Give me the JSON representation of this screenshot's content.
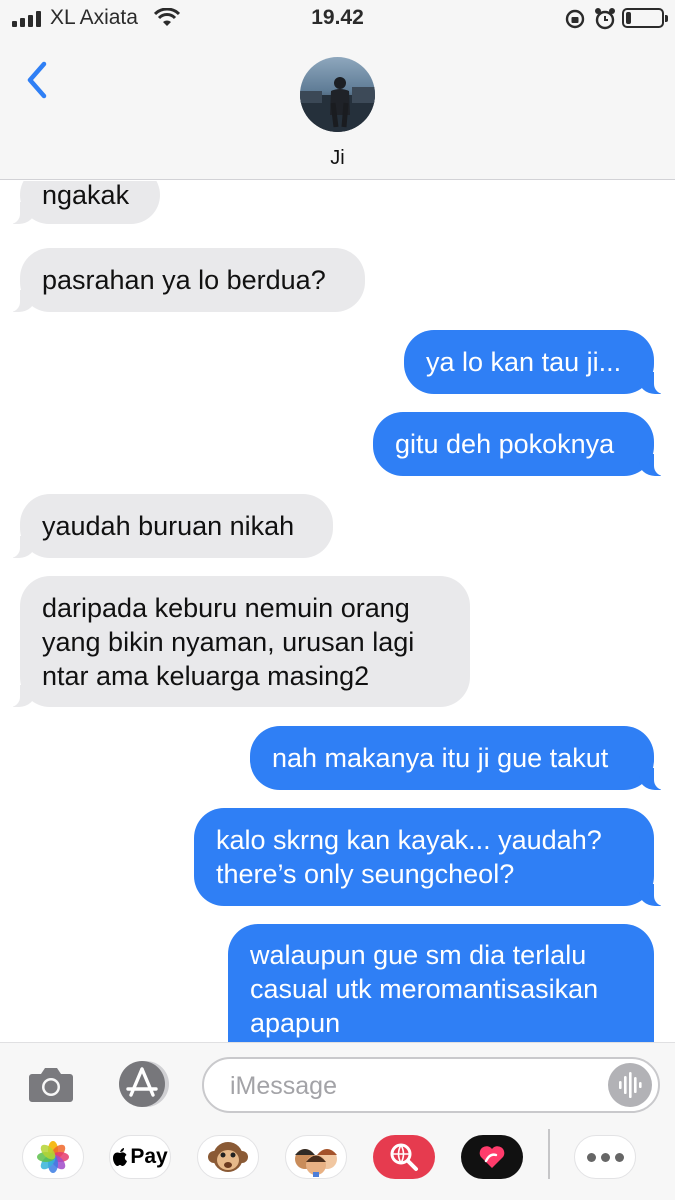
{
  "status_bar": {
    "carrier": "XL Axiata",
    "time": "19.42",
    "battery_level": 0.15
  },
  "header": {
    "contact_name": "Ji",
    "back_icon": "chevron-left-icon"
  },
  "messages": [
    {
      "direction": "incoming",
      "text": "ngakak"
    },
    {
      "direction": "incoming",
      "text": "pasrahan ya lo berdua?"
    },
    {
      "direction": "outgoing",
      "text": "ya lo kan tau ji..."
    },
    {
      "direction": "outgoing",
      "text": "gitu deh pokoknya"
    },
    {
      "direction": "incoming",
      "text": "yaudah buruan nikah"
    },
    {
      "direction": "incoming",
      "text": "daripada keburu nemuin orang\nyang bikin nyaman, urusan lagi\nntar ama keluarga masing2"
    },
    {
      "direction": "outgoing",
      "text": "nah makanya itu ji gue takut"
    },
    {
      "direction": "outgoing",
      "text": "kalo skrng kan kayak... yaudah?\nthere’s only seungcheol?"
    },
    {
      "direction": "outgoing",
      "text": "walaupun gue sm dia terlalu\ncasual utk meromantisasikan\napapun"
    }
  ],
  "compose": {
    "placeholder": "iMessage",
    "camera_icon": "camera-icon",
    "appstore_icon": "app-store-icon",
    "audio_icon": "audio-waveform-icon"
  },
  "app_drawer": {
    "apps": [
      {
        "name": "photos-app-icon"
      },
      {
        "name": "apple-pay-app",
        "label": "Pay"
      },
      {
        "name": "animoji-monkey-icon"
      },
      {
        "name": "memoji-icon"
      },
      {
        "name": "image-search-icon"
      },
      {
        "name": "digital-touch-icon"
      }
    ],
    "more_icon": "more-dots-icon"
  },
  "colors": {
    "outgoing_bubble": "#2f7ff5",
    "incoming_bubble": "#e9e9eb",
    "accent": "#2f7ff5"
  }
}
